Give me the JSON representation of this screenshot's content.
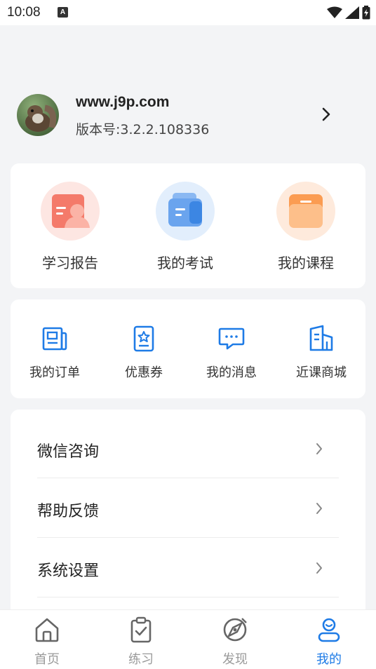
{
  "status_bar": {
    "time": "10:08",
    "notification_badge": "A"
  },
  "profile": {
    "name": "www.j9p.com",
    "version": "版本号:3.2.2.108336"
  },
  "quick_actions": [
    {
      "label": "学习报告",
      "icon": "study-report-icon"
    },
    {
      "label": "我的考试",
      "icon": "exam-icon"
    },
    {
      "label": "我的课程",
      "icon": "course-icon"
    }
  ],
  "services": [
    {
      "label": "我的订单",
      "icon": "order-icon"
    },
    {
      "label": "优惠券",
      "icon": "coupon-icon"
    },
    {
      "label": "我的消息",
      "icon": "message-icon"
    },
    {
      "label": "近课商城",
      "icon": "mall-icon"
    }
  ],
  "menu": [
    {
      "label": "微信咨询"
    },
    {
      "label": "帮助反馈"
    },
    {
      "label": "系统设置"
    }
  ],
  "tabs": [
    {
      "label": "首页",
      "icon": "home-icon"
    },
    {
      "label": "练习",
      "icon": "clipboard-check-icon"
    },
    {
      "label": "发现",
      "icon": "compass-icon"
    },
    {
      "label": "我的",
      "icon": "user-icon",
      "active": true
    }
  ],
  "colors": {
    "accent": "#1e7be6",
    "background": "#f3f4f6",
    "inactive_tab": "#9a9a9a"
  }
}
